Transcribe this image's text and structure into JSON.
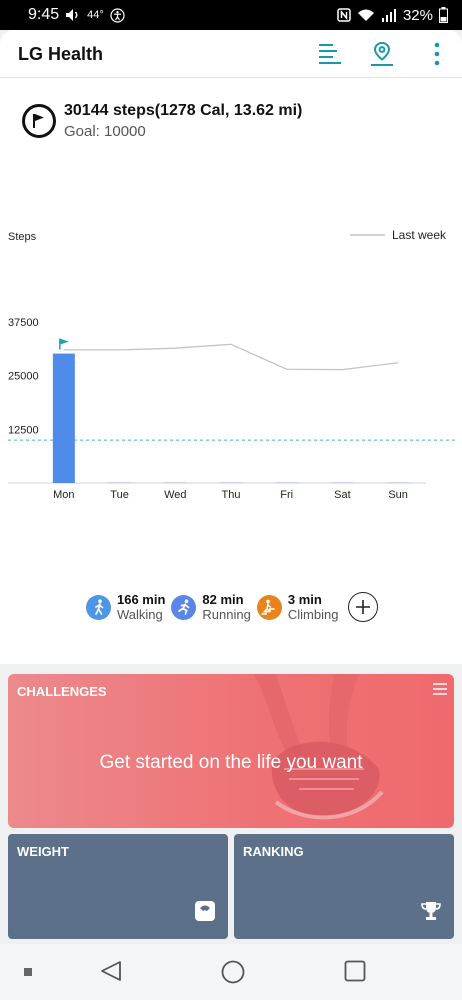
{
  "status": {
    "time": "9:45",
    "temp": "44°",
    "battery": "32%",
    "icons": [
      "volume-icon",
      "accessibility-icon",
      "nfc-icon",
      "wifi-icon",
      "signal-icon",
      "battery-icon"
    ]
  },
  "app": {
    "title": "LG Health",
    "actions": [
      "list-icon",
      "location-icon",
      "more-icon"
    ]
  },
  "summary": {
    "main": "30144 steps(1278 Cal, 13.62 mi)",
    "goal": "Goal: 10000"
  },
  "chart_data": {
    "type": "bar",
    "ylabel": "Steps",
    "categories": [
      "Mon",
      "Tue",
      "Wed",
      "Thu",
      "Fri",
      "Sat",
      "Sun"
    ],
    "yticks": [
      12500,
      25000,
      37500
    ],
    "ytick_labels": [
      "12500",
      "25000",
      "37500"
    ],
    "ylim": [
      0,
      37500
    ],
    "goal": 10000,
    "series": [
      {
        "values": [
          30144,
          0,
          0,
          0,
          0,
          0,
          0
        ],
        "color": "#4f8be8"
      },
      {
        "name": "Last week",
        "type": "line",
        "values": [
          31000,
          31000,
          31400,
          32300,
          26500,
          26400,
          28000
        ],
        "color": "#c4c4c4"
      }
    ],
    "legend": "top-right",
    "goal_line_color": "#3fb6c7"
  },
  "activities": [
    {
      "minutes": "166 min",
      "label": "Walking",
      "icon": "walking-icon",
      "color": "#4c96e6"
    },
    {
      "minutes": "82 min",
      "label": "Running",
      "icon": "running-icon",
      "color": "#5b86e8"
    },
    {
      "minutes": "3 min",
      "label": "Climbing",
      "icon": "climbing-icon",
      "color": "#e8841e"
    }
  ],
  "challenges": {
    "title": "CHALLENGES",
    "text": "Get started on the life you want",
    "color": "#ef7376"
  },
  "tiles": {
    "weight": {
      "title": "WEIGHT",
      "icon": "scale-icon"
    },
    "ranking": {
      "title": "RANKING",
      "icon": "trophy-icon"
    },
    "color": "#5d7089"
  },
  "nav": [
    "recent-dot-icon",
    "back-icon",
    "home-icon",
    "overview-icon"
  ]
}
